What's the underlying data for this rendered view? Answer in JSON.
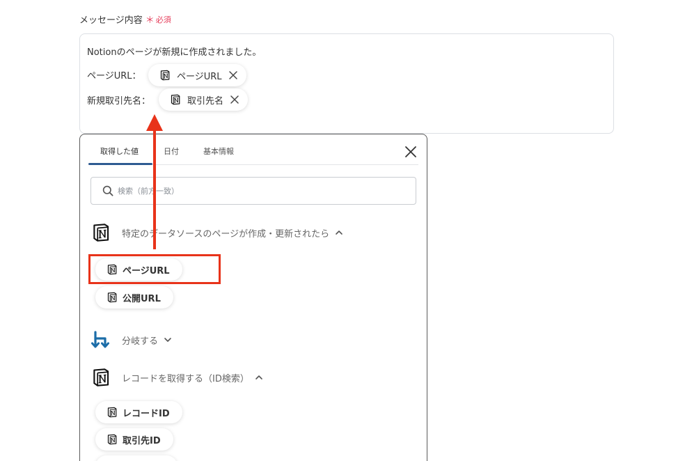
{
  "field": {
    "label": "メッセージ内容",
    "required_mark": "＊",
    "required_text": "必須"
  },
  "message": {
    "line1": "Notionのページが新規に作成されました。",
    "line2_label": "ページURL：",
    "line2_chip": "ページURL",
    "line3_label": "新規取引先名：",
    "line3_chip": "取引先名"
  },
  "panel": {
    "tabs": [
      {
        "label": "取得した値",
        "active": true
      },
      {
        "label": "日付",
        "active": false
      },
      {
        "label": "基本情報",
        "active": false
      }
    ],
    "search_placeholder": "検索（前方一致）",
    "sections": [
      {
        "title": "特定のデータソースのページが作成・更新されたら",
        "icon": "notion-icon",
        "expanded": true,
        "items": [
          "ページURL",
          "公開URL"
        ]
      },
      {
        "title": "分岐する",
        "icon": "branch-icon",
        "expanded": false,
        "items": []
      },
      {
        "title": "レコードを取得する（ID検索）",
        "icon": "notion-icon",
        "expanded": true,
        "items": [
          "レコードID",
          "取引先ID"
        ]
      }
    ]
  },
  "colors": {
    "annotation": "#e8331a",
    "required": "#e53e5b",
    "tab_underline": "#2f5b92",
    "branch_icon": "#1c6da8"
  }
}
